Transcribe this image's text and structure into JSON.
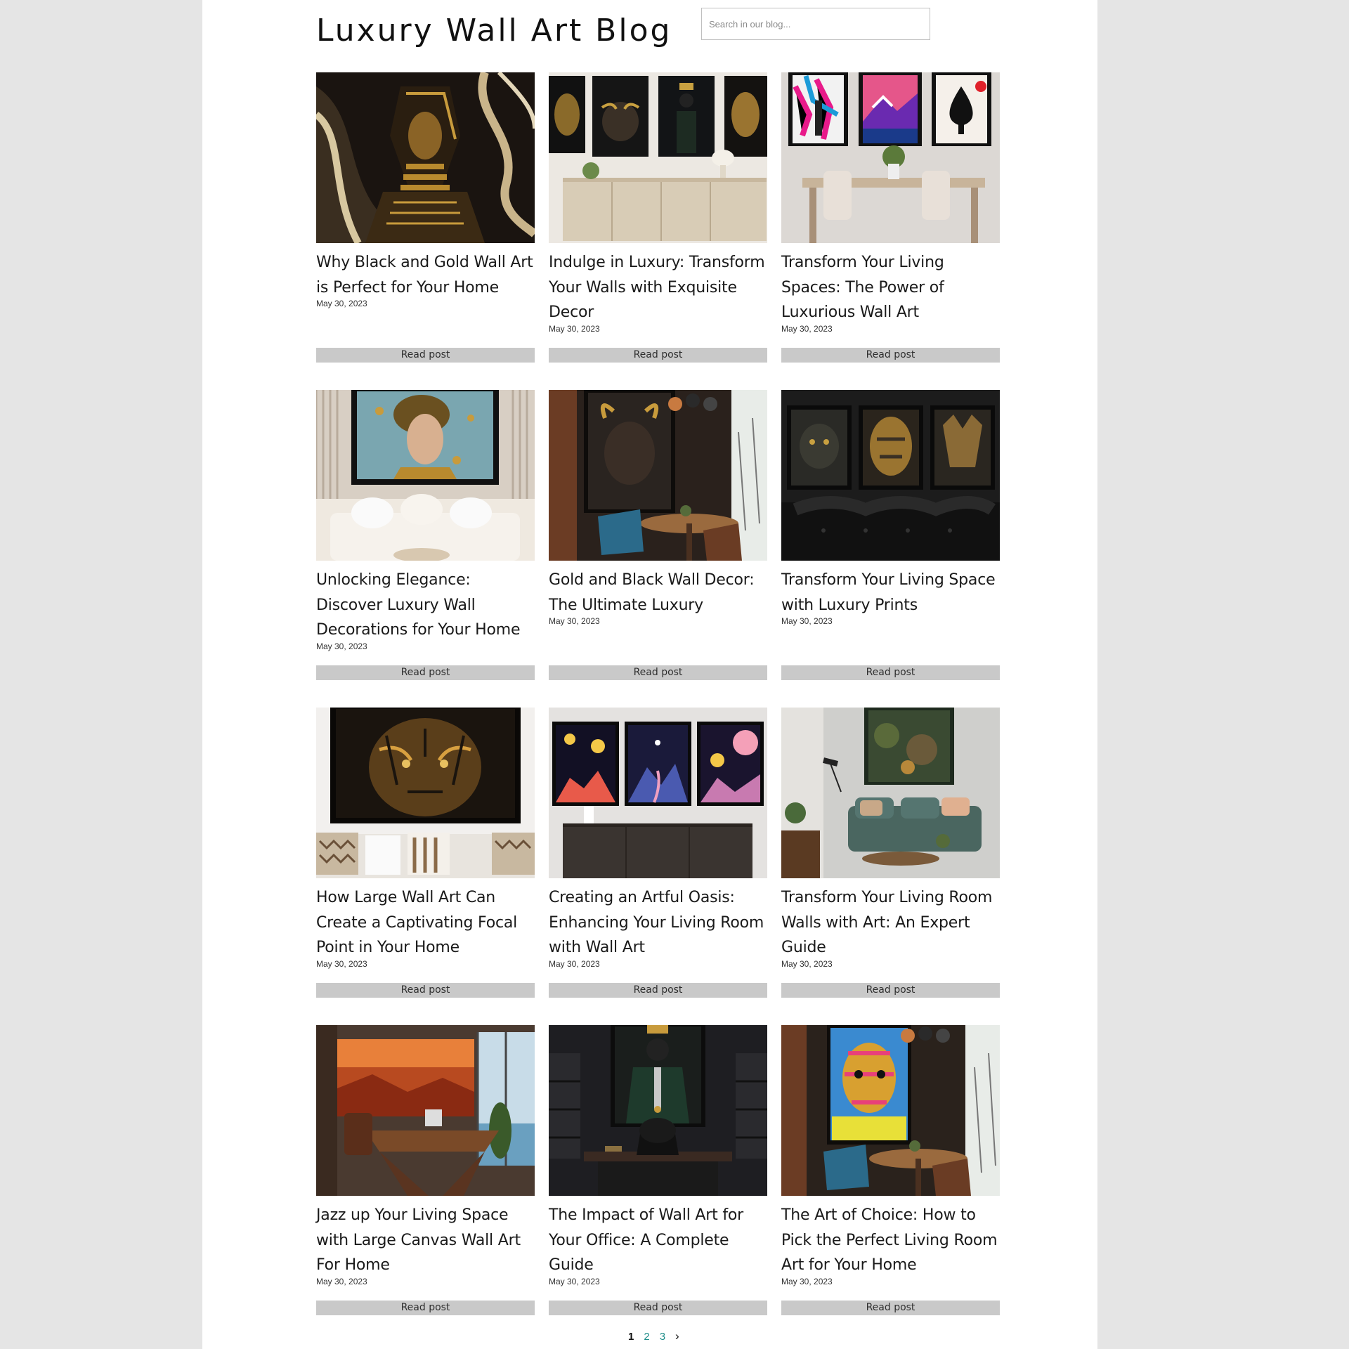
{
  "header": {
    "title": "Luxury Wall Art Blog",
    "search_placeholder": "Search in our blog..."
  },
  "posts": [
    {
      "title": "Why Black and Gold Wall Art is Perfect for Your Home",
      "date": "May 30, 2023",
      "button": "Read post",
      "image": "pharaoh-gold-portrait"
    },
    {
      "title": "Indulge in Luxury: Transform Your Walls with Exquisite Decor",
      "date": "May 30, 2023",
      "button": "Read post",
      "image": "four-black-gold-prints-over-sideboard"
    },
    {
      "title": "Transform Your Living Spaces: The Power of Luxurious Wall Art",
      "date": "May 30, 2023",
      "button": "Read post",
      "image": "colorful-triptych-over-dining-table"
    },
    {
      "title": "Unlocking Elegance: Discover Luxury Wall Decorations for Your Home",
      "date": "May 30, 2023",
      "button": "Read post",
      "image": "golden-woman-portrait-over-sofa"
    },
    {
      "title": "Gold and Black Wall Decor: The Ultimate Luxury",
      "date": "May 30, 2023",
      "button": "Read post",
      "image": "bull-portrait-in-lounge"
    },
    {
      "title": "Transform Your Living Space with Luxury Prints",
      "date": "May 30, 2023",
      "button": "Read post",
      "image": "three-animal-prints-over-leather-sofa"
    },
    {
      "title": "How Large Wall Art Can Create a Captivating Focal Point in Your Home",
      "date": "May 30, 2023",
      "button": "Read post",
      "image": "tiger-print-over-cushions"
    },
    {
      "title": "Creating an Artful Oasis: Enhancing Your Living Room with Wall Art",
      "date": "May 30, 2023",
      "button": "Read post",
      "image": "night-sky-triptych-over-cabinet"
    },
    {
      "title": "Transform Your Living Room Walls with Art: An Expert Guide",
      "date": "May 30, 2023",
      "button": "Read post",
      "image": "forest-painting-over-green-sofa"
    },
    {
      "title": "Jazz up Your Living Space with Large Canvas Wall Art For Home",
      "date": "May 30, 2023",
      "button": "Read post",
      "image": "sunset-canvas-in-office"
    },
    {
      "title": "The Impact of Wall Art for Your Office: A Complete Guide",
      "date": "May 30, 2023",
      "button": "Read post",
      "image": "suited-figure-over-dark-desk"
    },
    {
      "title": "The Art of Choice: How to Pick the Perfect Living Room Art for Your Home",
      "date": "May 30, 2023",
      "button": "Read post",
      "image": "pop-art-portrait-in-lounge"
    }
  ],
  "pagination": {
    "current": "1",
    "pages": [
      "2",
      "3"
    ],
    "next": "›"
  }
}
